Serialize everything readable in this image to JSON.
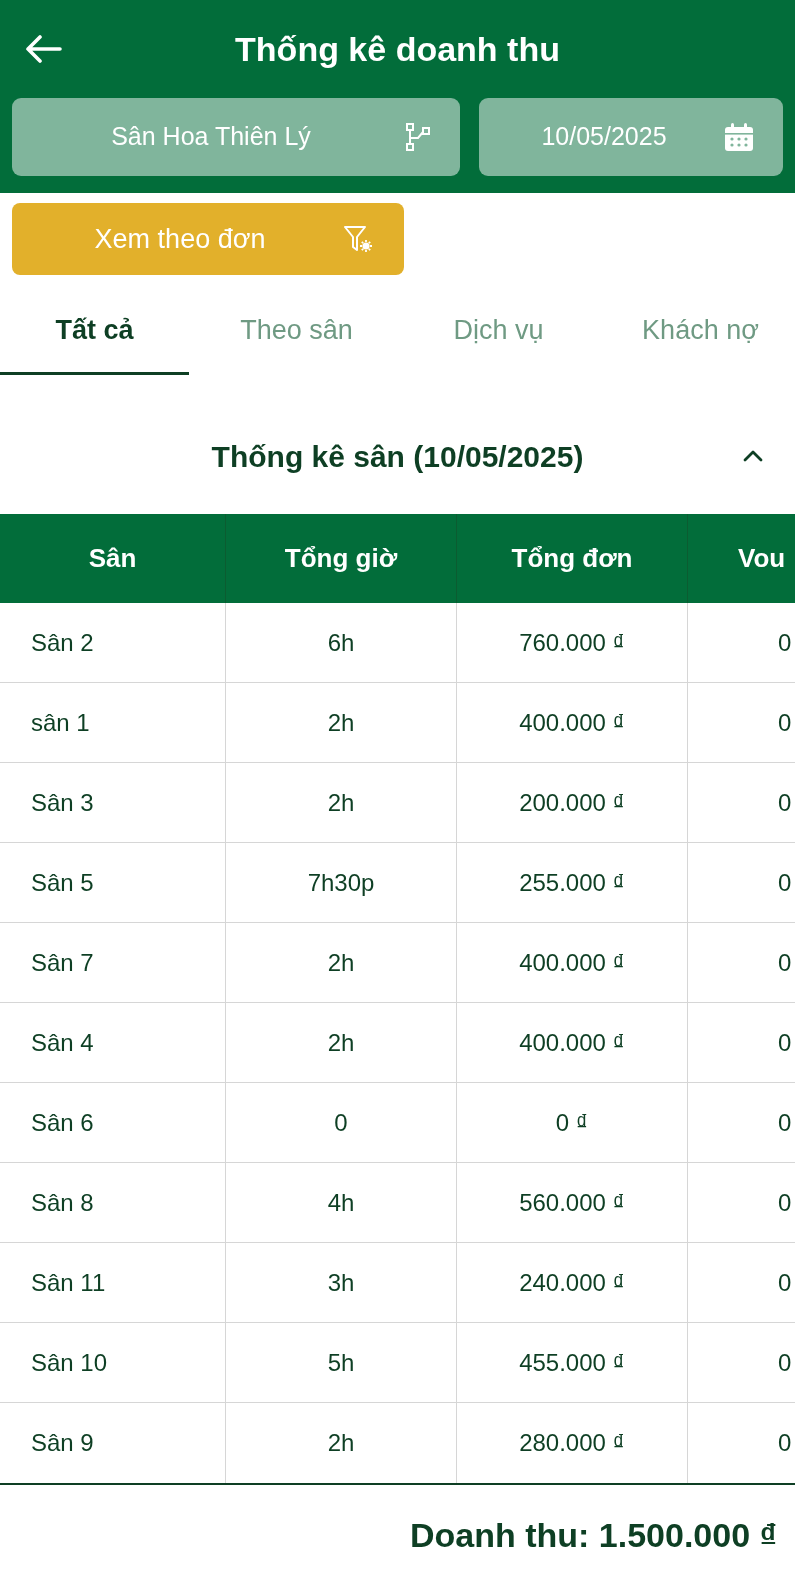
{
  "header": {
    "title": "Thống kê doanh thu"
  },
  "filters": [
    {
      "kind": "branch",
      "value": "Sân Hoa Thiên Lý"
    },
    {
      "kind": "date",
      "value": "10/05/2025"
    }
  ],
  "view_button": {
    "label": "Xem theo đơn"
  },
  "tabs": [
    {
      "label": "Tất cả",
      "selected": true
    },
    {
      "label": "Theo sân",
      "selected": false
    },
    {
      "label": "Dịch vụ",
      "selected": false
    },
    {
      "label": "Khách nợ",
      "selected": false
    }
  ],
  "section": {
    "title": "Thống kê sân (10/05/2025)",
    "expanded": true
  },
  "table": {
    "columns": [
      "Sân",
      "Tổng giờ",
      "Tổng đơn",
      "Vou"
    ],
    "rows": [
      [
        "Sân 2",
        "6h",
        "760.000 ₫",
        "0"
      ],
      [
        "sân 1",
        "2h",
        "400.000 ₫",
        "0"
      ],
      [
        "Sân 3",
        "2h",
        "200.000 ₫",
        "0"
      ],
      [
        "Sân 5",
        "7h30p",
        "255.000 ₫",
        "0"
      ],
      [
        "Sân 7",
        "2h",
        "400.000 ₫",
        "0"
      ],
      [
        "Sân 4",
        "2h",
        "400.000 ₫",
        "0"
      ],
      [
        "Sân 6",
        "0",
        "0 ₫",
        "0"
      ],
      [
        "Sân 8",
        "4h",
        "560.000 ₫",
        "0"
      ],
      [
        "Sân 11",
        "3h",
        "240.000 ₫",
        "0"
      ],
      [
        "Sân 10",
        "5h",
        "455.000 ₫",
        "0"
      ],
      [
        "Sân 9",
        "2h",
        "280.000 ₫",
        "0"
      ]
    ]
  },
  "footer": {
    "revenue": "Doanh thu: 1.500.000 ₫"
  }
}
